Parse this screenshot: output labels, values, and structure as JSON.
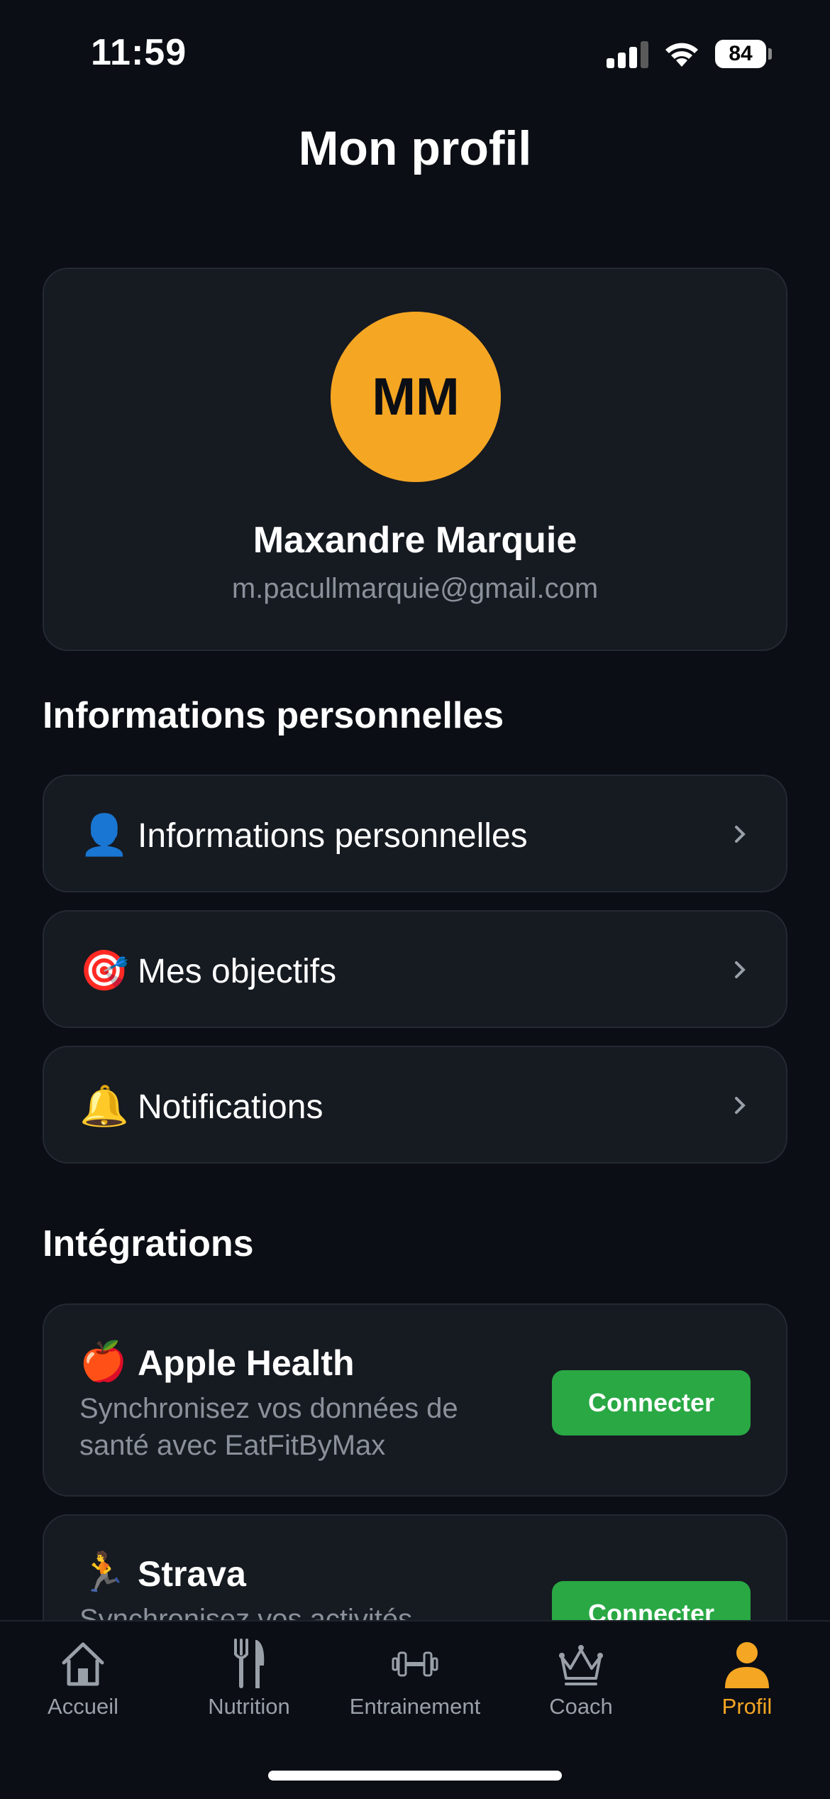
{
  "status_bar": {
    "time": "11:59",
    "battery": "84"
  },
  "page_title": "Mon profil",
  "profile": {
    "initials": "MM",
    "name": "Maxandre Marquie",
    "email": "m.pacullmarquie@gmail.com",
    "avatar_color": "#f5a623"
  },
  "personal_section": {
    "title": "Informations personnelles",
    "items": [
      {
        "emoji": "👤",
        "label": "Informations personnelles",
        "icon": "user-icon"
      },
      {
        "emoji": "🎯",
        "label": "Mes objectifs",
        "icon": "target-icon"
      },
      {
        "emoji": "🔔",
        "label": "Notifications",
        "icon": "bell-icon"
      }
    ]
  },
  "integrations_section": {
    "title": "Intégrations",
    "items": [
      {
        "emoji": "🍎",
        "name": "Apple Health",
        "description": "Synchronisez vos données de santé avec EatFitByMax",
        "button": "Connecter"
      },
      {
        "emoji": "🏃",
        "name": "Strava",
        "description": "Synchronisez vos activités",
        "button": "Connecter"
      }
    ]
  },
  "tab_bar": {
    "tabs": [
      {
        "label": "Accueil",
        "icon": "home-icon"
      },
      {
        "label": "Nutrition",
        "icon": "fork-knife-icon"
      },
      {
        "label": "Entrainement",
        "icon": "dumbbell-icon"
      },
      {
        "label": "Coach",
        "icon": "crown-icon"
      },
      {
        "label": "Profil",
        "icon": "person-icon",
        "active": true
      }
    ],
    "active_color": "#f5a623"
  },
  "colors": {
    "background": "#0b0e14",
    "card": "#161a21",
    "accent": "#f5a623",
    "success": "#29a844"
  }
}
